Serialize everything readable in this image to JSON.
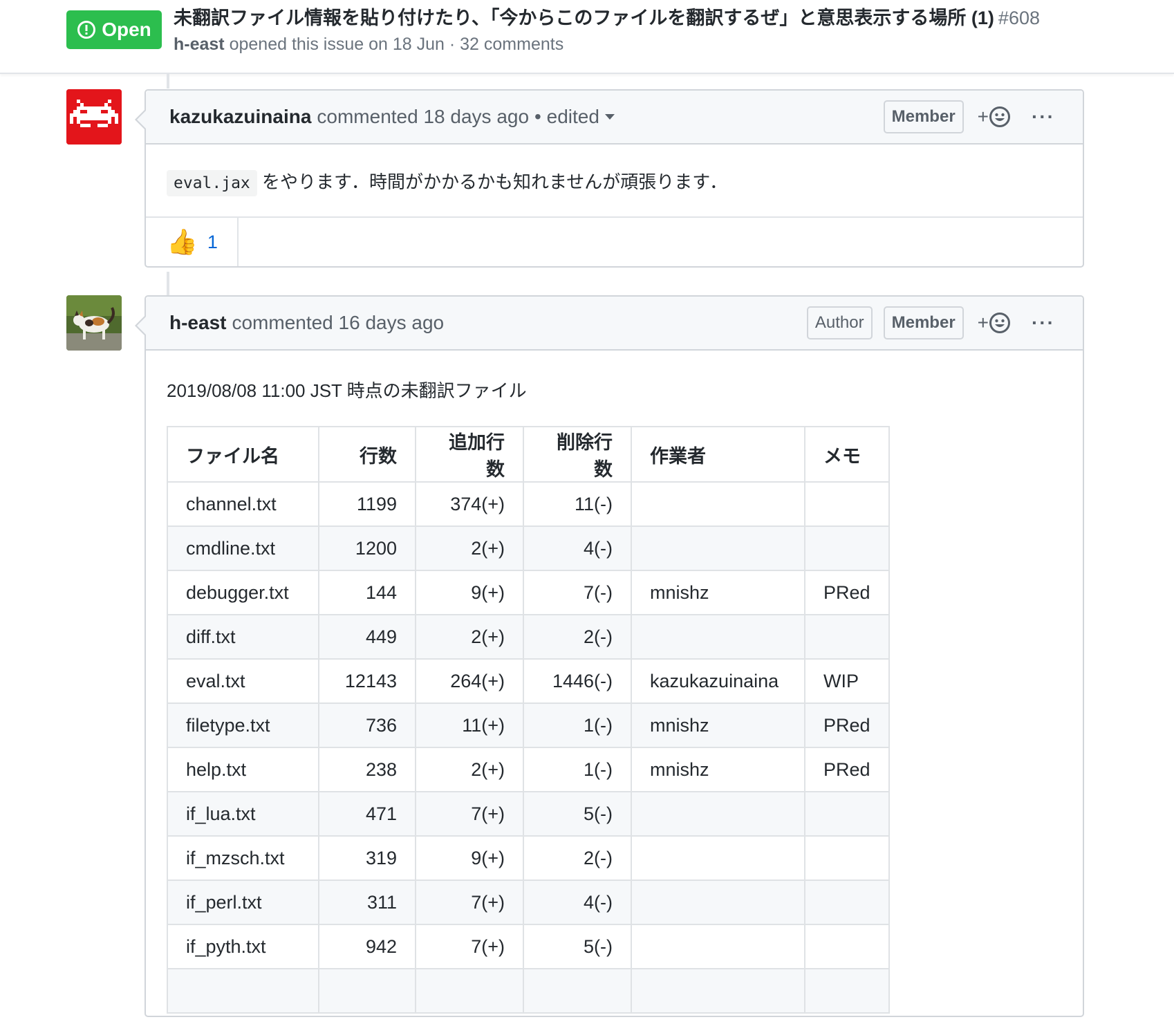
{
  "issue": {
    "state": "Open",
    "title": "未翻訳ファイル情報を貼り付けたり、「今からこのファイルを翻訳するぜ」と意思表示する場所 (1)",
    "number": "#608",
    "author": "h-east",
    "meta_rest": "opened this issue on 18 Jun · 32 comments"
  },
  "comments": [
    {
      "author": "kazukazuinaina",
      "action": "commented 18 days ago",
      "edited": "• edited",
      "roles": [
        "Member"
      ],
      "body_code": "eval.jax",
      "body_text": "をやります．時間がかかるかも知れませんが頑張ります．",
      "reactions": [
        {
          "icon": "thumbs-up",
          "emoji": "👍",
          "count": "1"
        }
      ]
    },
    {
      "author": "h-east",
      "action": "commented 16 days ago",
      "roles": [
        "Author",
        "Member"
      ],
      "body_text": "2019/08/08 11:00 JST 時点の未翻訳ファイル",
      "table": {
        "headers": [
          "ファイル名",
          "行数",
          "追加行数",
          "削除行数",
          "作業者",
          "メモ"
        ],
        "rows": [
          [
            "channel.txt",
            "1199",
            "374(+)",
            "11(-)",
            "",
            ""
          ],
          [
            "cmdline.txt",
            "1200",
            "2(+)",
            "4(-)",
            "",
            ""
          ],
          [
            "debugger.txt",
            "144",
            "9(+)",
            "7(-)",
            "mnishz",
            "PRed"
          ],
          [
            "diff.txt",
            "449",
            "2(+)",
            "2(-)",
            "",
            ""
          ],
          [
            "eval.txt",
            "12143",
            "264(+)",
            "1446(-)",
            "kazukazuinaina",
            "WIP"
          ],
          [
            "filetype.txt",
            "736",
            "11(+)",
            "1(-)",
            "mnishz",
            "PRed"
          ],
          [
            "help.txt",
            "238",
            "2(+)",
            "1(-)",
            "mnishz",
            "PRed"
          ],
          [
            "if_lua.txt",
            "471",
            "7(+)",
            "5(-)",
            "",
            ""
          ],
          [
            "if_mzsch.txt",
            "319",
            "9(+)",
            "2(-)",
            "",
            ""
          ],
          [
            "if_perl.txt",
            "311",
            "7(+)",
            "4(-)",
            "",
            ""
          ],
          [
            "if_pyth.txt",
            "942",
            "7(+)",
            "5(-)",
            "",
            ""
          ],
          [
            "",
            "",
            "",
            "",
            "",
            ""
          ]
        ]
      }
    }
  ],
  "colors": {
    "open_green": "#2cbe4e",
    "link_blue": "#0366d6",
    "invader_red": "#e3151b"
  }
}
